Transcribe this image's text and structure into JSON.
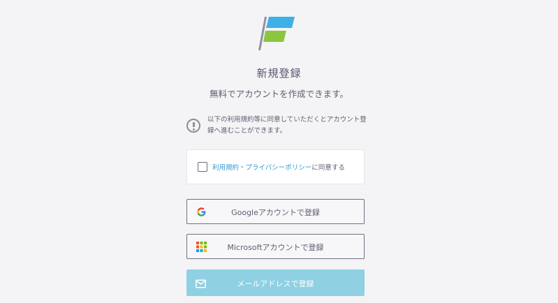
{
  "brand": {
    "logo_icon": "flag-logo-icon",
    "colors": {
      "logo_blue": "#3fb0e6",
      "logo_green": "#8cc63f",
      "logo_pole": "#8f8fa0"
    }
  },
  "header": {
    "title": "新規登録",
    "subtitle": "無料でアカウントを作成できます。"
  },
  "notice": {
    "icon": "exclamation-circle-icon",
    "text": "以下の利用規約等に同意していただくとアカウント登録へ進むことができます。"
  },
  "agreement": {
    "checked": false,
    "link_text": "利用規約・プライバシーポリシー",
    "suffix_text": "に同意する",
    "link_color": "#2f9ad3"
  },
  "signup_buttons": {
    "google": {
      "label": "Googleアカウントで登録",
      "icon": "google-icon"
    },
    "microsoft": {
      "label": "Microsoftアカウントで登録",
      "icon": "microsoft-icon"
    },
    "email": {
      "label": "メールアドレスで登録",
      "icon": "envelope-icon",
      "bg_color": "#8fd0e3"
    }
  }
}
